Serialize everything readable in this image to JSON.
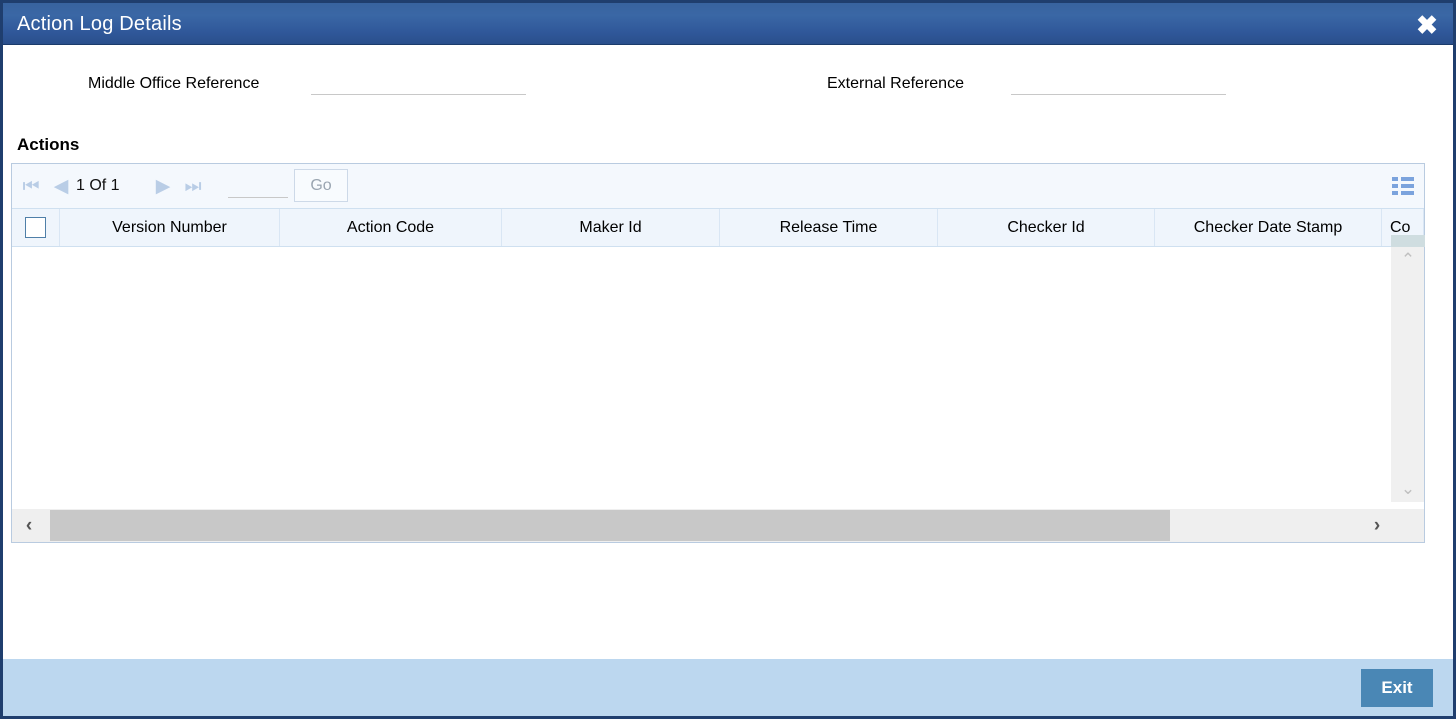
{
  "window": {
    "title": "Action Log Details",
    "close_icon": "close-icon"
  },
  "form": {
    "middle_office_reference": {
      "label": "Middle Office Reference",
      "value": "",
      "placeholder": ""
    },
    "external_reference": {
      "label": "External Reference",
      "value": "",
      "placeholder": ""
    }
  },
  "actions_section": {
    "title": "Actions",
    "toolbar": {
      "first_icon": "⏮",
      "prev_icon": "◀",
      "page_indicator": "1  Of  1",
      "next_icon": "▶",
      "last_icon": "⏭",
      "goto_value": "",
      "goto_placeholder": "",
      "go_label": "Go",
      "grid_view_icon": "grid-view-icon"
    },
    "grid": {
      "select_all_checked": false,
      "columns": [
        "Version Number",
        "Action Code",
        "Maker Id",
        "Release Time",
        "Checker Id",
        "Checker Date Stamp",
        "Co"
      ],
      "rows": [],
      "empty": true
    },
    "scrollbars": {
      "v_up_icon": "⌃",
      "v_down_icon": "⌄",
      "h_left_icon": "‹",
      "h_right_icon": "›"
    }
  },
  "footer": {
    "exit_label": "Exit"
  },
  "colors": {
    "titlebar_start": "#38639f",
    "titlebar_end": "#2a4f8c",
    "frame_border": "#1f3e6e",
    "footer_bg": "#bcd7ef",
    "exit_bg": "#4a87b5",
    "grid_header_bg": "#eff5fc",
    "toolbar_bg": "#f4f8fd",
    "nav_arrow": "#b9cde6",
    "scroll_thumb": "#c8c8c8"
  }
}
